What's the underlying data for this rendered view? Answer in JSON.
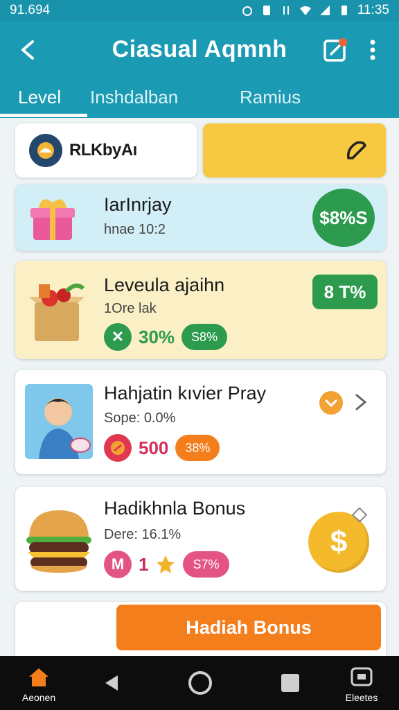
{
  "status_bar": {
    "time_left": "91.694",
    "time_right": "11:35"
  },
  "app_bar": {
    "title": "Ciasual  Aqmnh"
  },
  "tabs": [
    {
      "label": "Level"
    },
    {
      "label": "Inshdalban"
    },
    {
      "label": "Ramius"
    }
  ],
  "top_left_card": {
    "brand": "RLKbyAı"
  },
  "cards": [
    {
      "title": "IarInrjay",
      "subtitle": "hnae 10:2",
      "price": "$8%S"
    },
    {
      "title": "Leveula ajaihn",
      "subtitle": "1Ore lak",
      "badge": "8 T%",
      "icon_glyph": "✕",
      "value": "30%",
      "pill": "S8%"
    },
    {
      "title": "Hahjatin kıvier Pray",
      "subtitle": "Sope: 0.0%",
      "value": "500",
      "pill": "38%"
    },
    {
      "title": "Hadikhnla Bonus",
      "subtitle": "Dere: 16.1%",
      "icon_glyph": "M",
      "value": "1",
      "pill": "S7%",
      "coin_glyph": "$"
    }
  ],
  "bonus_button": {
    "label": "Hadiah Bonus"
  },
  "nav": {
    "home_label": "Aeonen",
    "right_label": "Eleetes"
  },
  "colors": {
    "primary": "#1a9ab3",
    "accent": "#f47d1c",
    "green": "#2d9b4e",
    "yellow": "#f7c842"
  }
}
